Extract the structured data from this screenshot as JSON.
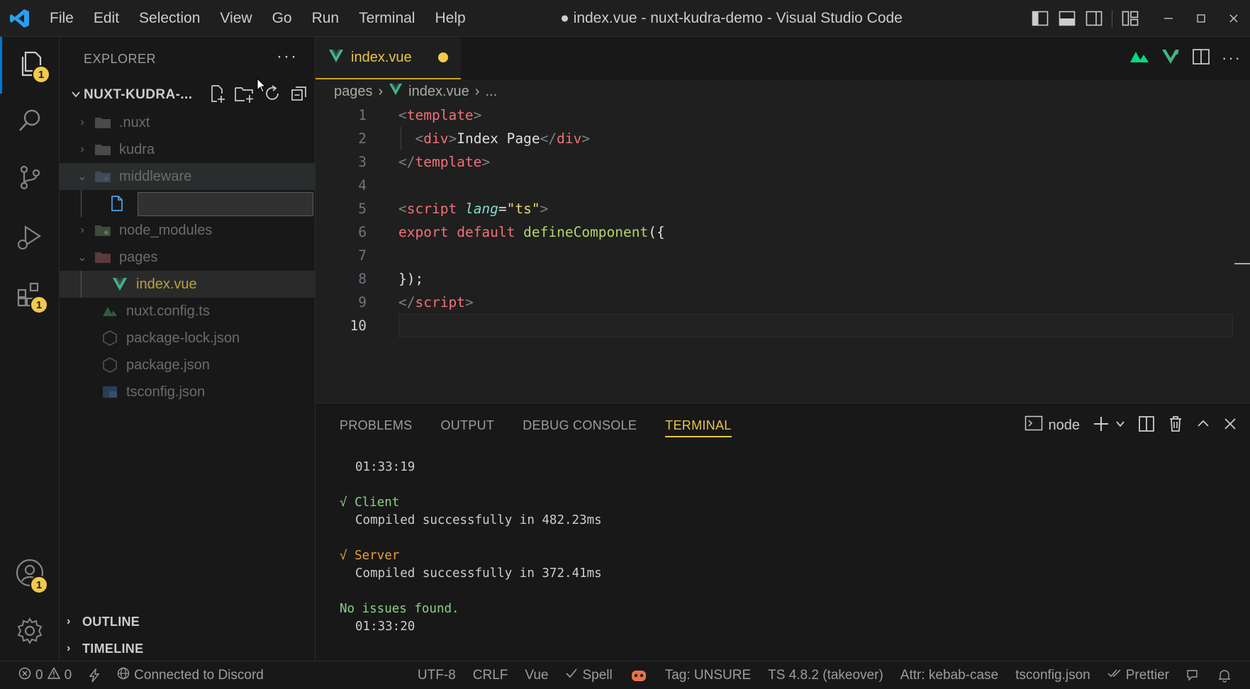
{
  "window": {
    "title": "● index.vue - nuxt-kudra-demo - Visual Studio Code",
    "menu": [
      "File",
      "Edit",
      "Selection",
      "View",
      "Go",
      "Run",
      "Terminal",
      "Help"
    ]
  },
  "activity": {
    "explorer_badge": "1",
    "extensions_badge": "1",
    "accounts_badge": "1"
  },
  "explorer": {
    "header": "EXPLORER",
    "folder": "NUXT-KUDRA-...",
    "items": [
      {
        "label": ".nuxt",
        "type": "folder",
        "expanded": false
      },
      {
        "label": "kudra",
        "type": "folder",
        "expanded": false
      },
      {
        "label": "middleware",
        "type": "folder",
        "expanded": true
      },
      {
        "label": "",
        "type": "new-file-input"
      },
      {
        "label": "node_modules",
        "type": "folder",
        "expanded": false
      },
      {
        "label": "pages",
        "type": "folder",
        "expanded": true
      },
      {
        "label": "index.vue",
        "type": "vue"
      },
      {
        "label": "nuxt.config.ts",
        "type": "nuxt"
      },
      {
        "label": "package-lock.json",
        "type": "json"
      },
      {
        "label": "package.json",
        "type": "json"
      },
      {
        "label": "tsconfig.json",
        "type": "ts"
      }
    ],
    "outline": "OUTLINE",
    "timeline": "TIMELINE"
  },
  "editor": {
    "tab_label": "index.vue",
    "breadcrumb": [
      "pages",
      "index.vue",
      "..."
    ],
    "line_numbers": [
      "1",
      "2",
      "3",
      "4",
      "5",
      "6",
      "7",
      "8",
      "9",
      "10"
    ],
    "current_line": "10"
  },
  "panel": {
    "tabs": [
      "PROBLEMS",
      "OUTPUT",
      "DEBUG CONSOLE",
      "TERMINAL"
    ],
    "active_tab": "TERMINAL",
    "terminal_name": "node",
    "lines": {
      "t1": "01:33:19",
      "client": "√ Client",
      "client_msg": "Compiled successfully in 482.23ms",
      "server": "√ Server",
      "server_msg": "Compiled successfully in 372.41ms",
      "no_issues": "No issues found.",
      "t2": "01:33:20"
    }
  },
  "status": {
    "errors": "0",
    "warnings": "0",
    "discord": "Connected to Discord",
    "encoding": "UTF-8",
    "eol": "CRLF",
    "language": "Vue",
    "spell": "Spell",
    "tag": "Tag: UNSURE",
    "ts": "TS 4.8.2 (takeover)",
    "attr": "Attr: kebab-case",
    "tsconfig": "tsconfig.json",
    "prettier": "Prettier"
  },
  "colors": {
    "accent": "#0078d4",
    "badge": "#f2c94c",
    "tab_active_text": "#e8c547",
    "vue_green": "#41b883"
  }
}
